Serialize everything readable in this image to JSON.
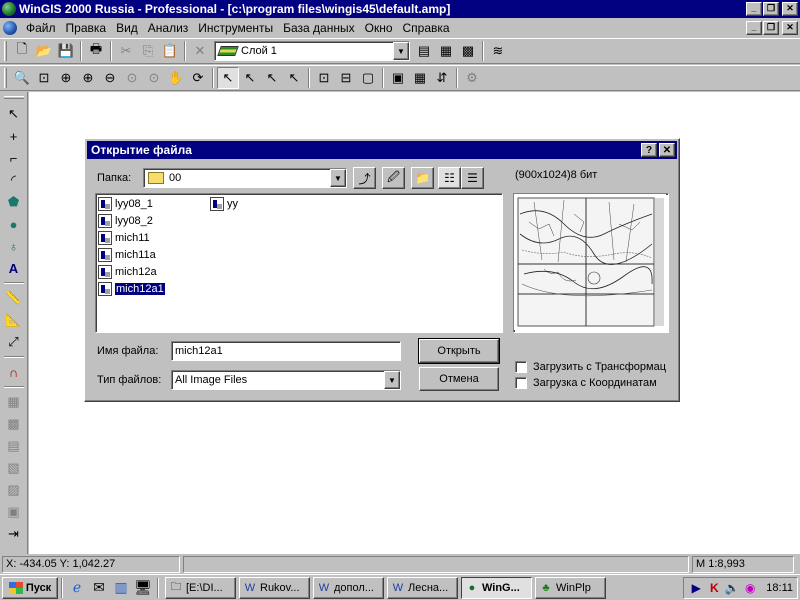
{
  "app": {
    "title": "WinGIS 2000 Russia - Professional - [c:\\program files\\wingis45\\default.amp]",
    "window_buttons": [
      "_",
      "❐",
      "✕"
    ]
  },
  "menu": [
    "Файл",
    "Правка",
    "Вид",
    "Анализ",
    "Инструменты",
    "База данных",
    "Окно",
    "Справка"
  ],
  "toolbar1": {
    "layer_value": "Слой 1"
  },
  "dialog": {
    "title": "Открытие файла",
    "folder_label": "Папка:",
    "folder_value": "00",
    "files": [
      "lyy08_1",
      "lyy08_2",
      "mich11",
      "mich11a",
      "mich12a",
      "mich12a1",
      "yy"
    ],
    "selected_file": "mich12a1",
    "preview_info": "(900x1024)8 бит",
    "filename_label": "Имя файла:",
    "filename_value": "mich12a1",
    "filetype_label": "Тип файлов:",
    "filetype_value": "All Image Files",
    "open_button": "Открыть",
    "cancel_button": "Отмена",
    "checkbox_transform": "Загрузить с Трансформац",
    "checkbox_coords": "Загрузка с Координатам"
  },
  "status": {
    "coords": "X: -434.05 Y: 1,042.27",
    "scale": "M 1:8,993"
  },
  "taskbar": {
    "start": "Пуск",
    "tasks": [
      "[E:\\DI...",
      "Rukov...",
      "допол...",
      "Лесна...",
      "WinG...",
      "WinPlp"
    ],
    "active_task": "WinG...",
    "clock": "18:11"
  }
}
